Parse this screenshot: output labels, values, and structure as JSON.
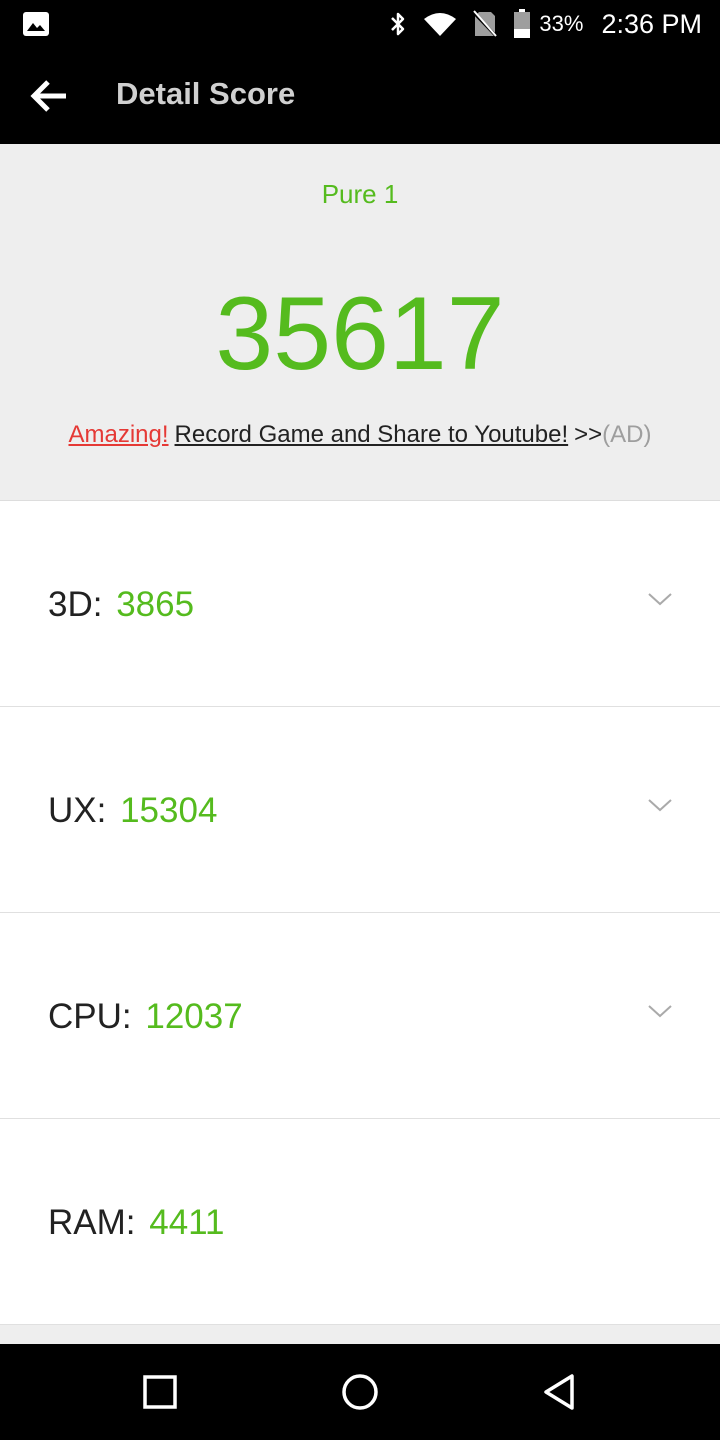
{
  "status_bar": {
    "battery_percent": "33%",
    "time": "2:36 PM",
    "icons": [
      "image-notification-icon",
      "bluetooth-icon",
      "wifi-icon",
      "no-sim-icon",
      "battery-icon"
    ]
  },
  "app_bar": {
    "title": "Detail Score"
  },
  "score_panel": {
    "device_name": "Pure 1",
    "total_score": "35617",
    "ad": {
      "highlight": "Amazing!",
      "text": "Record Game and Share to Youtube!",
      "arrows": ">>",
      "tag": "(AD)"
    }
  },
  "scores": [
    {
      "label": "3D:",
      "value": "3865",
      "expandable": true
    },
    {
      "label": "UX:",
      "value": "15304",
      "expandable": true
    },
    {
      "label": "CPU:",
      "value": "12037",
      "expandable": true
    },
    {
      "label": "RAM:",
      "value": "4411",
      "expandable": false
    }
  ],
  "nav_bar": {
    "buttons": [
      "recents-button",
      "home-button",
      "back-button"
    ]
  },
  "colors": {
    "accent_green": "#55bb1e",
    "ad_red": "#e53935",
    "bar_black": "#000000",
    "panel_gray": "#eeeeee"
  }
}
